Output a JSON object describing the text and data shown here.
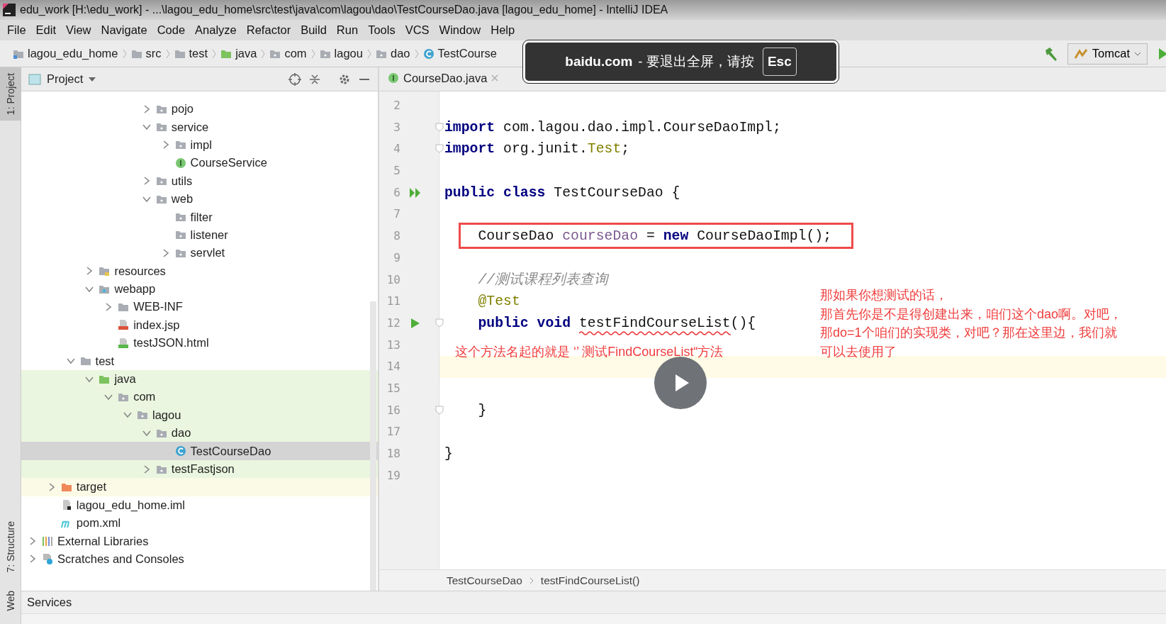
{
  "window": {
    "title": "edu_work [H:\\edu_work] - ...\\lagou_edu_home\\src\\test\\java\\com\\lagou\\dao\\TestCourseDao.java [lagou_edu_home] - IntelliJ IDEA"
  },
  "menu": [
    "File",
    "Edit",
    "View",
    "Navigate",
    "Code",
    "Analyze",
    "Refactor",
    "Build",
    "Run",
    "Tools",
    "VCS",
    "Window",
    "Help"
  ],
  "nav_path": [
    {
      "label": "lagou_edu_home",
      "kind": "module"
    },
    {
      "label": "src",
      "kind": "folder"
    },
    {
      "label": "test",
      "kind": "folder"
    },
    {
      "label": "java",
      "kind": "sources"
    },
    {
      "label": "com",
      "kind": "package"
    },
    {
      "label": "lagou",
      "kind": "package"
    },
    {
      "label": "dao",
      "kind": "package"
    },
    {
      "label": "TestCourse",
      "kind": "class"
    }
  ],
  "run_config": {
    "label": "Tomcat"
  },
  "tool_stripe": [
    {
      "label": "1: Project",
      "selected": true
    },
    {
      "label": "7: Structure",
      "selected": false
    },
    {
      "label": "Web",
      "selected": false
    }
  ],
  "project_panel": {
    "title": "Project",
    "tree": [
      {
        "children": [
          {
            "children": [
              {
                "children": [
                  {
                    "children": [
                      {
                        "children": [
                          {
                            "children": [
                              {
                                "label": "pojo",
                                "kind": "package",
                                "expanded": false,
                                "selected": false
                              },
                              {
                                "label": "service",
                                "kind": "package",
                                "expanded": true,
                                "selected": false,
                                "children": [
                                  {
                                    "label": "impl",
                                    "kind": "package",
                                    "expanded": false,
                                    "selected": false
                                  },
                                  {
                                    "label": "CourseService",
                                    "kind": "interface",
                                    "selected": false
                                  }
                                ]
                              },
                              {
                                "label": "utils",
                                "kind": "package",
                                "expanded": false,
                                "selected": false
                              },
                              {
                                "label": "web",
                                "kind": "package",
                                "expanded": true,
                                "selected": false,
                                "children": [
                                  {
                                    "label": "filter",
                                    "kind": "package",
                                    "selected": false
                                  },
                                  {
                                    "label": "listener",
                                    "kind": "package",
                                    "selected": false
                                  },
                                  {
                                    "label": "servlet",
                                    "kind": "package",
                                    "expanded": false,
                                    "selected": false
                                  }
                                ]
                              }
                            ]
                          }
                        ]
                      }
                    ]
                  },
                  {
                    "label": "resources",
                    "kind": "resources",
                    "expanded": false,
                    "selected": false
                  },
                  {
                    "label": "webapp",
                    "kind": "webapp",
                    "expanded": true,
                    "selected": false,
                    "children": [
                      {
                        "label": "WEB-INF",
                        "kind": "folder",
                        "expanded": false,
                        "selected": false
                      },
                      {
                        "label": "index.jsp",
                        "kind": "jsp",
                        "selected": false
                      },
                      {
                        "label": "testJSON.html",
                        "kind": "html",
                        "selected": false
                      }
                    ]
                  }
                ]
              },
              {
                "label": "test",
                "kind": "folder",
                "expanded": true,
                "selected": false,
                "children": [
                  {
                    "label": "java",
                    "kind": "sources",
                    "expanded": true,
                    "selected": false,
                    "color": "#eaf6df",
                    "children": [
                      {
                        "label": "com",
                        "kind": "package",
                        "expanded": true,
                        "selected": false,
                        "color": "#eaf6df",
                        "children": [
                          {
                            "label": "lagou",
                            "kind": "package",
                            "expanded": true,
                            "selected": false,
                            "color": "#eaf6df",
                            "children": [
                              {
                                "label": "dao",
                                "kind": "package",
                                "expanded": true,
                                "selected": false,
                                "color": "#eaf6df",
                                "children": [
                                  {
                                    "label": "TestCourseDao",
                                    "kind": "class",
                                    "selected": true
                                  }
                                ]
                              },
                              {
                                "label": "testFastjson",
                                "kind": "package",
                                "expanded": false,
                                "selected": false,
                                "color": "#eaf6df"
                              }
                            ]
                          }
                        ]
                      }
                    ]
                  }
                ]
              }
            ]
          },
          {
            "label": "target",
            "kind": "excluded",
            "expanded": false,
            "selected": false,
            "color": "#fbfae6"
          },
          {
            "label": "lagou_edu_home.iml",
            "kind": "iml",
            "selected": false
          },
          {
            "label": "pom.xml",
            "kind": "maven",
            "selected": false
          }
        ]
      },
      {
        "label": "External Libraries",
        "kind": "libraries",
        "expanded": false,
        "selected": false
      },
      {
        "label": "Scratches and Consoles",
        "kind": "scratches",
        "expanded": false,
        "selected": false
      }
    ]
  },
  "editor": {
    "tabs": [
      {
        "label": "CourseDao.java",
        "kind": "interface",
        "selected": false
      }
    ],
    "lines": [
      {
        "number": "2"
      },
      {
        "number": "3",
        "gutter": [
          {
            "kind": "fold"
          }
        ],
        "tokens": [
          {
            "kind": "keyword",
            "text": "import"
          },
          {
            "kind": "plain",
            "text": " com.lagou.dao.impl.CourseDaoImpl;"
          }
        ]
      },
      {
        "number": "4",
        "gutter": [
          {
            "kind": "fold"
          }
        ],
        "tokens": [
          {
            "kind": "keyword",
            "text": "import"
          },
          {
            "kind": "plain",
            "text": " org.junit."
          },
          {
            "kind": "annotation",
            "text": "Test"
          },
          {
            "kind": "plain",
            "text": ";"
          }
        ]
      },
      {
        "number": "5"
      },
      {
        "number": "6",
        "gutter": [
          {
            "kind": "run-all"
          }
        ],
        "tokens": [
          {
            "kind": "keyword",
            "text": "public class"
          },
          {
            "kind": "plain",
            "text": " TestCourseDao {"
          }
        ]
      },
      {
        "number": "7"
      },
      {
        "number": "8",
        "framed": true,
        "tokens": [
          {
            "kind": "plain",
            "text": "    CourseDao "
          },
          {
            "kind": "field",
            "text": "courseDao"
          },
          {
            "kind": "plain",
            "text": " = "
          },
          {
            "kind": "keyword",
            "text": "new"
          },
          {
            "kind": "plain",
            "text": " CourseDaoImpl();"
          }
        ]
      },
      {
        "number": "9"
      },
      {
        "number": "10",
        "tokens": [
          {
            "kind": "comment",
            "text": "    //测试课程列表查询"
          }
        ]
      },
      {
        "number": "11",
        "tokens": [
          {
            "kind": "annotation",
            "text": "    @Test"
          }
        ]
      },
      {
        "number": "12",
        "gutter": [
          {
            "kind": "run"
          },
          {
            "kind": "fold"
          }
        ],
        "tokens": [
          {
            "kind": "keyword",
            "text": "    public void"
          },
          {
            "kind": "plain",
            "text": " testFindCourseList",
            "underlined": true
          },
          {
            "kind": "plain",
            "text": "(){"
          }
        ]
      },
      {
        "number": "13"
      },
      {
        "number": "14",
        "current": true
      },
      {
        "number": "15"
      },
      {
        "number": "16",
        "gutter": [
          {
            "kind": "fold"
          }
        ],
        "tokens": [
          {
            "kind": "plain",
            "text": "    }"
          }
        ]
      },
      {
        "number": "17"
      },
      {
        "number": "18",
        "tokens": [
          {
            "kind": "plain",
            "text": "}"
          }
        ]
      },
      {
        "number": "19"
      }
    ],
    "breadcrumb": [
      "TestCourseDao",
      "testFindCourseList()"
    ]
  },
  "services": {
    "title": "Services"
  },
  "fullscreen_notice": {
    "site": "baidu.com",
    "message": "- 要退出全屏，请按",
    "key": "Esc"
  },
  "player": {
    "paused": true
  },
  "notes": [
    {
      "lines": [
        "这个方法名起的就是 ‘’ 测试FindCourseList“方法"
      ]
    },
    {
      "lines": [
        "那如果你想测试的话，",
        "那首先你是不是得创建出来，咱们这个dao啊。对吧，",
        "那do=1个咱们的实现类，对吧？那在这里边，我们就",
        "可以去使用了"
      ]
    }
  ]
}
